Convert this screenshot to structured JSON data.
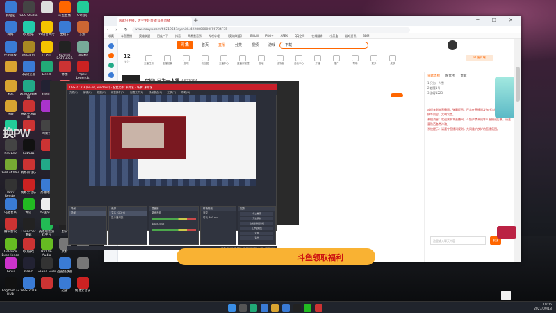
{
  "desktop": {
    "big_text": "换PW",
    "icons": [
      {
        "label": "此电脑",
        "color": "#3a7bd5"
      },
      {
        "label": "OBS Studio",
        "color": "#444"
      },
      {
        "label": "",
        "color": "#ddd"
      },
      {
        "label": "斗鱼直播",
        "color": "#f60"
      },
      {
        "label": "QQ音乐",
        "color": "#2c9"
      },
      {
        "label": "网络",
        "color": "#3a7bd5"
      },
      {
        "label": "QQ音乐",
        "color": "#2ca"
      },
      {
        "label": "YY语音大厅",
        "color": "#f5c400"
      },
      {
        "label": "出租车",
        "color": "#3a7bd5"
      },
      {
        "label": "火影",
        "color": "#c63"
      },
      {
        "label": "控制面板",
        "color": "#3a7bd5"
      },
      {
        "label": "WeGame",
        "color": "#a82"
      },
      {
        "label": "YY语音",
        "color": "#f5c400"
      },
      {
        "label": "PLAYER BATTLEGR",
        "color": "#222"
      },
      {
        "label": "Snake",
        "color": "#7a9"
      },
      {
        "label": "",
        "color": "#d9a431"
      },
      {
        "label": "QQ浏览器",
        "color": "#3a7bd5"
      },
      {
        "label": "Deezl",
        "color": "#2a7"
      },
      {
        "label": "修图",
        "color": "#c33"
      },
      {
        "label": "Apex Legends",
        "color": "#c22"
      },
      {
        "label": "游戏",
        "color": "#d9a431"
      },
      {
        "label": "网易UU加速器",
        "color": "#2a8"
      },
      {
        "label": "Steam",
        "color": "#223"
      },
      {
        "label": "Origin",
        "color": "#e66"
      },
      {
        "label": "Epic Games Launcher",
        "color": "#222"
      },
      {
        "label": "迷聊",
        "color": "#d9a431"
      },
      {
        "label": "腾讯手游助手",
        "color": "#c33"
      },
      {
        "label": "",
        "color": "#a3c"
      },
      {
        "label": "战双帕弥什",
        "color": "#c33"
      },
      {
        "label": "RunSteam",
        "color": "#55c"
      },
      {
        "label": "",
        "color": "#2c9"
      },
      {
        "label": "",
        "color": "#c33"
      },
      {
        "label": "网易云",
        "color": "#444"
      },
      {
        "label": "",
        "color": "#55a"
      },
      {
        "label": "素材 2022093",
        "color": "#777"
      },
      {
        "label": "Rift Lab",
        "color": "#444"
      },
      {
        "label": "CapCut",
        "color": "#111"
      },
      {
        "label": "",
        "color": "#c33"
      },
      {
        "label": "素材 2022093",
        "color": "#777"
      },
      {
        "label": "",
        "color": "#777"
      },
      {
        "label": "God of War",
        "color": "#7a3"
      },
      {
        "label": "网易云音乐",
        "color": "#c33"
      },
      {
        "label": "",
        "color": "#2a8"
      },
      {
        "label": "Dota 2",
        "color": "#a22"
      },
      {
        "label": "素材 2022093",
        "color": "#777"
      },
      {
        "label": "Tarrk Render",
        "color": "#333"
      },
      {
        "label": "网易云音乐",
        "color": "#c22"
      },
      {
        "label": "高德地图",
        "color": "#3a7bd5"
      },
      {
        "label": "Apex 剪辑",
        "color": "#c22"
      },
      {
        "label": "TeamSpeak",
        "color": "#2a6"
      },
      {
        "label": "电脑管家",
        "color": "#3a7bd5"
      },
      {
        "label": "微信",
        "color": "#2b2"
      },
      {
        "label": "哔哩哔哩",
        "color": "#eee"
      },
      {
        "label": "素材 2022093",
        "color": "#777"
      },
      {
        "label": "雷神",
        "color": "#2c7"
      },
      {
        "label": "腾讯会议",
        "color": "#c33"
      },
      {
        "label": "Launcher 雷蛇",
        "color": "#222"
      },
      {
        "label": "英雄联盟游戏平台",
        "color": "#2b5"
      },
      {
        "label": "剪辑",
        "color": "#222"
      },
      {
        "label": "",
        "color": "#777"
      },
      {
        "label": "GeForce Experience",
        "color": "#6b2"
      },
      {
        "label": "QQ游戏",
        "color": "#c33"
      },
      {
        "label": "NVIDIA Audio",
        "color": "#6b2"
      },
      {
        "label": "素材",
        "color": "#777"
      },
      {
        "label": "",
        "color": "#777"
      },
      {
        "label": "iTunes",
        "color": "#c3c"
      },
      {
        "label": "steam",
        "color": "#223"
      },
      {
        "label": "Sound Lock",
        "color": "#333"
      },
      {
        "label": "迅雷播放器",
        "color": "#3a7bd5"
      },
      {
        "label": "",
        "color": "#777"
      },
      {
        "label": "Logitech G HUB",
        "color": "#111"
      },
      {
        "label": "WPS 2019",
        "color": "#3a7bd5"
      },
      {
        "label": "",
        "color": "#c33"
      },
      {
        "label": "迅雷",
        "color": "#3a7bd5"
      },
      {
        "label": "网易云音乐",
        "color": "#c22"
      }
    ]
  },
  "browser": {
    "tab_title": "居家好主播，大学生好直播!斗鱼直播",
    "url": "www.douyu.com/6621954?dyshid=4228800000FF6734FE5",
    "favorites": [
      "收藏",
      "斗鱼直播",
      "英雄联盟",
      "百度一下",
      "抖音",
      "网易云音乐",
      "哔哩哔哩",
      "【英雄联盟】",
      "Bilibili",
      "PRO+",
      "APEX",
      "QQ空间",
      "在线翻译",
      "小黑盒",
      "游戏资讯",
      "3DM"
    ]
  },
  "douyu": {
    "logo": "斗鱼",
    "nav": [
      "首页",
      "直播",
      "分类",
      "视频",
      "游戏",
      "下载"
    ],
    "counter": {
      "value": "12",
      "label": "关注"
    },
    "categories": [
      "主播任务",
      "主播招募",
      "鱼吧",
      "粉丝团",
      "主播中心",
      "直播间管理",
      "鱼塘",
      "创作者",
      "活动中心",
      "开播",
      "推广",
      "帮助",
      "更多",
      "皮肤"
    ],
    "top_btn": "PC客户端",
    "streamer": {
      "title": "房间: 只为一人雪",
      "room_id": "6621954",
      "meta": "主播等级 · 分区: 英雄联盟 · 直播时长 00:01",
      "avatar_text": "只为一人"
    },
    "follow_btn": "关注"
  },
  "obs": {
    "title": "OBS 27.2.3 (64-bit, windows) - 配置文件: 未命名 - 场景: 未命名",
    "menu": [
      "文件(F)",
      "编辑(E)",
      "视图(V)",
      "停靠部件(D)",
      "配置文件(P)",
      "场景集合(S)",
      "工具(T)",
      "帮助(H)"
    ],
    "docks": {
      "scenes": {
        "title": "场景",
        "items": [
          "场景"
        ]
      },
      "sources": {
        "title": "来源",
        "items": [
          "文本 (GDI+)",
          "显示器采集"
        ]
      },
      "mixer": {
        "title": "混音器",
        "items": [
          "桌面音频",
          "麦克风/Aux"
        ]
      },
      "transitions": {
        "title": "转场特效",
        "items": [
          "渐变",
          "时长 300 ms"
        ]
      },
      "controls": {
        "title": "控制",
        "items": [
          "停止推流",
          "开始录制",
          "启动虚拟摄像机",
          "工作室模式",
          "设置",
          "退出"
        ]
      }
    },
    "status": "LIVE: 00:00:05   REC: 00:00:00   CPU: 3.2%, 60.00 fps"
  },
  "chat": {
    "tabs": [
      "贡献周榜",
      "粉丝团",
      "贵宾"
    ],
    "rank": [
      "1  只为一人雪",
      "2  超管1号",
      "3  游客1223"
    ],
    "messages": [
      "欢迎来到本直播间，弹幕提示：严禁在直播间发布违法违规、低俗色情等内容，文明发言。",
      "系统消息：欢迎来到本直播间，斗鱼严禁未成年人直播或打赏，请注意防范各类诈骗。",
      "系统提示：请遵守直播间规则，共同维护良好的直播氛围。"
    ],
    "input_placeholder": "这里输入聊天内容",
    "send_label": "发送"
  },
  "banner": {
    "text": "斗鱼领取福利"
  },
  "taskbar": {
    "time": "19:06",
    "date": "2023/09/18"
  }
}
